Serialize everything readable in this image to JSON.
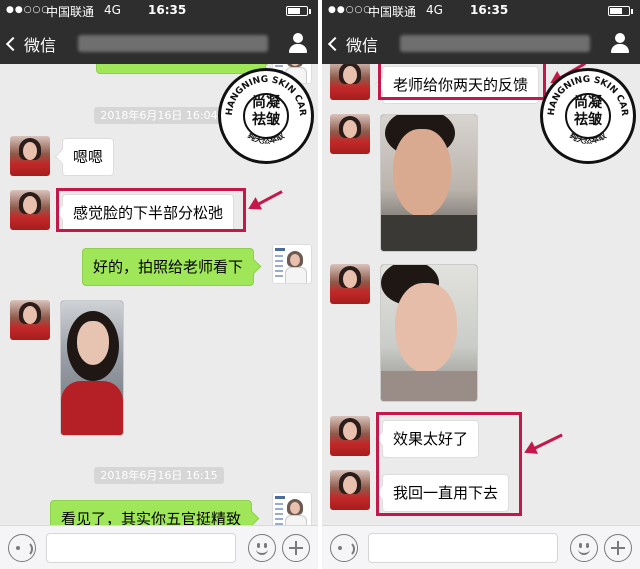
{
  "status": {
    "carrier": "中国联通",
    "network": "4G",
    "time": "16:35",
    "signal": "●●○○○"
  },
  "nav": {
    "back_label": "微信"
  },
  "stamp": {
    "brand_line1": "尚凝",
    "brand_line2": "祛皱",
    "ring_top": "SHANGNING SKIN CARE",
    "ring_bottom": "纯天然萃取"
  },
  "left": {
    "timestamps": [
      "2018年6月16日 16:04",
      "2018年6月16日 16:15"
    ],
    "messages": [
      {
        "from": "customer",
        "text": "嗯嗯"
      },
      {
        "from": "customer",
        "text": "感觉脸的下半部分松弛"
      },
      {
        "from": "teacher",
        "text": "好的，拍照给老师看下"
      },
      {
        "from": "customer",
        "type": "photo"
      },
      {
        "from": "teacher",
        "text": "看见了，其实你五官挺精致"
      }
    ]
  },
  "right": {
    "messages": [
      {
        "from": "customer",
        "text": "老师给你两天的反馈"
      },
      {
        "from": "customer",
        "type": "photo"
      },
      {
        "from": "customer",
        "type": "photo"
      },
      {
        "from": "customer",
        "text": "效果太好了"
      },
      {
        "from": "customer",
        "text": "我回一直用下去"
      }
    ]
  },
  "colors": {
    "nav_bg": "#2e2e2e",
    "chat_bg": "#ebebeb",
    "outgoing_bubble": "#9fe658",
    "highlight": "#c4184b"
  },
  "icons": [
    "back-chevron-icon",
    "person-icon",
    "voice-icon",
    "emoji-icon",
    "plus-icon",
    "battery-icon",
    "signal-icon"
  ]
}
